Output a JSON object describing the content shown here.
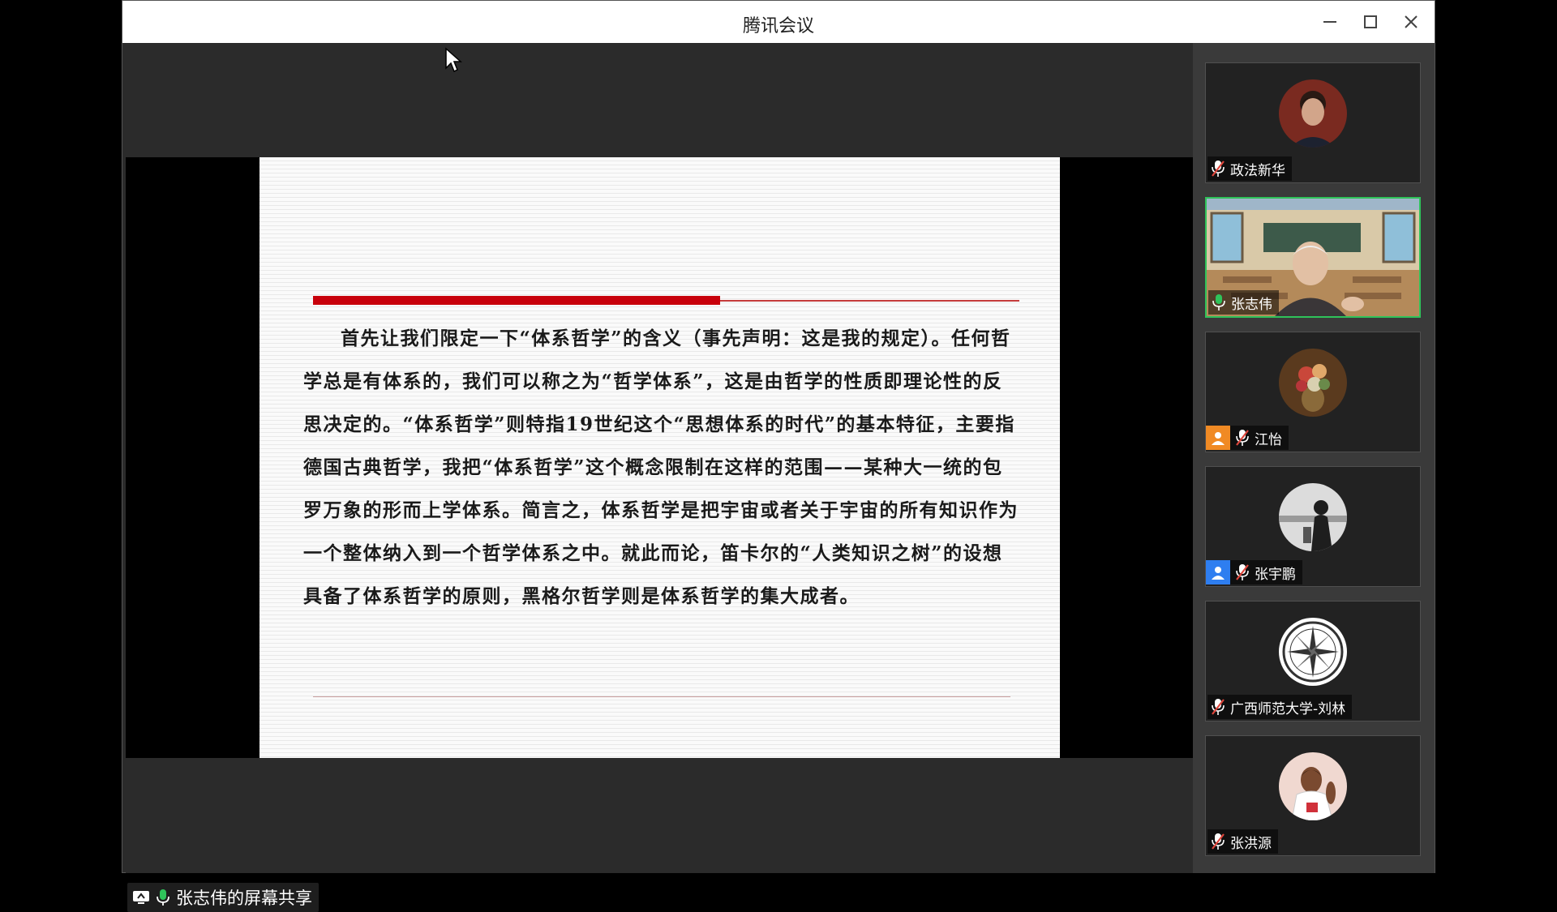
{
  "window": {
    "title": "腾讯会议",
    "controls": [
      "minimize-icon",
      "maximize-icon",
      "close-icon"
    ]
  },
  "slide": {
    "text": "首先让我们限定一下“体系哲学”的含义（事先声明：这是我的规定）。任何哲学总是有体系的，我们可以称之为“哲学体系”，这是由哲学的性质即理论性的反思决定的。“体系哲学”则特指19世纪这个“思想体系的时代”的基本特征，主要指德国古典哲学，我把“体系哲学”这个概念限制在这样的范围——某种大一统的包罗万象的形而上学体系。简言之，体系哲学是把宇宙或者关于宇宙的所有知识作为一个整体纳入到一个哲学体系之中。就此而论，笛卡尔的“人类知识之树”的设想具备了体系哲学的原则，黑格尔哲学则是体系哲学的集大成者。"
  },
  "share_status": {
    "label": "张志伟的屏幕共享",
    "icons": [
      "screen-share-icon",
      "microphone-icon"
    ]
  },
  "participants": [
    {
      "name": "政法新华",
      "mic": "muted",
      "role": "",
      "speaking": false
    },
    {
      "name": "张志伟",
      "mic": "on",
      "role": "",
      "speaking": true
    },
    {
      "name": "江怡",
      "mic": "muted",
      "role": "host",
      "speaking": false
    },
    {
      "name": "张宇鹏",
      "mic": "muted",
      "role": "co-host",
      "speaking": false
    },
    {
      "name": "广西师范大学-刘林",
      "mic": "muted",
      "role": "",
      "speaking": false
    },
    {
      "name": "张洪源",
      "mic": "muted",
      "role": "",
      "speaking": false
    }
  ],
  "colors": {
    "speaking_border": "#2fc35a",
    "muted_icon": "#e0463c",
    "host_badge": "#f08a24",
    "cohost_badge": "#2e7ef0",
    "slide_accent": "#c8000b"
  }
}
